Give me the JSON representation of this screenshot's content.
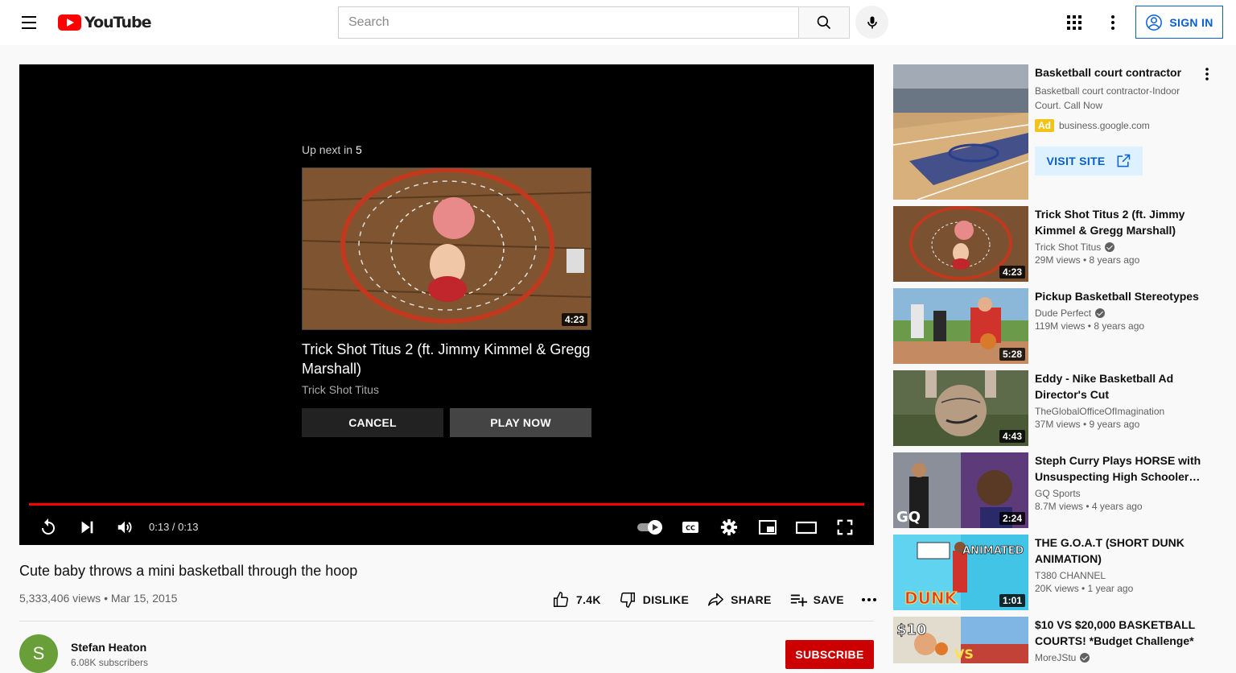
{
  "header": {
    "logo_text": "YouTube",
    "search_placeholder": "Search",
    "signin_label": "SIGN IN"
  },
  "player": {
    "upnext_label": "Up next in",
    "upnext_countdown": "5",
    "upnext_title": "Trick Shot Titus 2 (ft. Jimmy Kimmel & Gregg Marshall)",
    "upnext_channel": "Trick Shot Titus",
    "upnext_duration": "4:23",
    "cancel_label": "CANCEL",
    "playnow_label": "PLAY NOW",
    "time": "0:13 / 0:13",
    "progress": 1.0,
    "accent_color": "#ff0000"
  },
  "video": {
    "title": "Cute baby throws a mini basketball through the hoop",
    "meta": "5,333,406 views • Mar 15, 2015",
    "like_count": "7.4K",
    "dislike_label": "DISLIKE",
    "share_label": "SHARE",
    "save_label": "SAVE",
    "channel_name": "Stefan Heaton",
    "channel_initial": "S",
    "channel_subs": "6.08K subscribers",
    "subscribe_label": "SUBSCRIBE"
  },
  "ad": {
    "title": "Basketball court contractor",
    "description": "Basketball court contractor-Indoor Court. Call Now",
    "badge": "Ad",
    "domain": "business.google.com",
    "visit_label": "VISIT SITE"
  },
  "recommendations": [
    {
      "title": "Trick Shot Titus 2 (ft. Jimmy Kimmel & Gregg Marshall)",
      "channel": "Trick Shot Titus",
      "verified": true,
      "meta": "29M views • 8 years ago",
      "duration": "4:23"
    },
    {
      "title": "Pickup Basketball Stereotypes",
      "channel": "Dude Perfect",
      "verified": true,
      "meta": "119M views • 8 years ago",
      "duration": "5:28"
    },
    {
      "title": "Eddy - Nike Basketball Ad Director's Cut",
      "channel": "TheGlobalOfficeOfImagination",
      "verified": false,
      "meta": "37M views • 9 years ago",
      "duration": "4:43"
    },
    {
      "title": "Steph Curry Plays HORSE with Unsuspecting High Schoolers |...",
      "channel": "GQ Sports",
      "verified": false,
      "meta": "8.7M views • 4 years ago",
      "duration": "2:24"
    },
    {
      "title": "THE G.O.A.T (SHORT DUNK ANIMATION)",
      "channel": "T380 CHANNEL",
      "verified": false,
      "meta": "20K views • 1 year ago",
      "duration": "1:01"
    },
    {
      "title": "$10 VS $20,000 BASKETBALL COURTS! *Budget Challenge*",
      "channel": "MoreJStu",
      "verified": true,
      "meta": "",
      "duration": ""
    }
  ]
}
